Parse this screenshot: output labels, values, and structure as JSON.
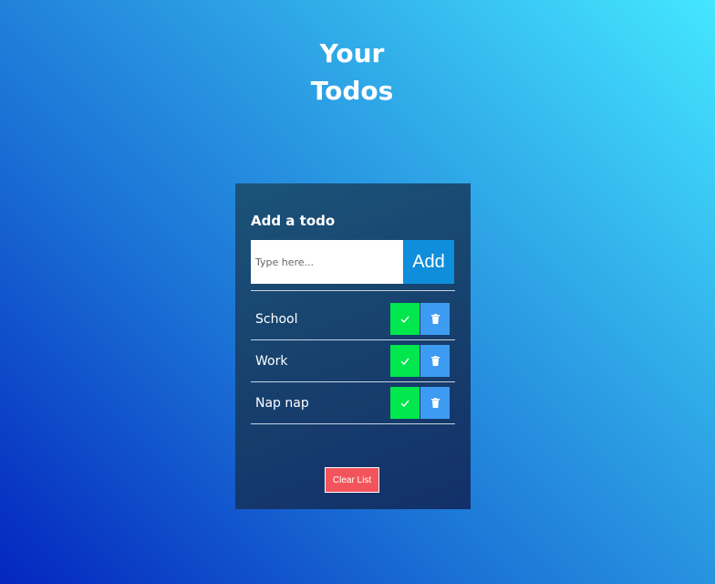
{
  "header": {
    "title_line1": "Your",
    "title_line2": "Todos"
  },
  "card": {
    "heading": "Add a todo",
    "input": {
      "placeholder": "Type here...",
      "value": ""
    },
    "add_label": "Add",
    "todos": [
      {
        "label": "School"
      },
      {
        "label": "Work"
      },
      {
        "label": "Nap nap"
      }
    ],
    "clear_label": "Clear List"
  },
  "icons": {
    "done": "check-icon",
    "delete": "trash-icon"
  },
  "colors": {
    "done_button": "#00e64d",
    "delete_button": "#3d9cf2",
    "add_button": "#0f8edb",
    "clear_button": "#f3545c"
  }
}
